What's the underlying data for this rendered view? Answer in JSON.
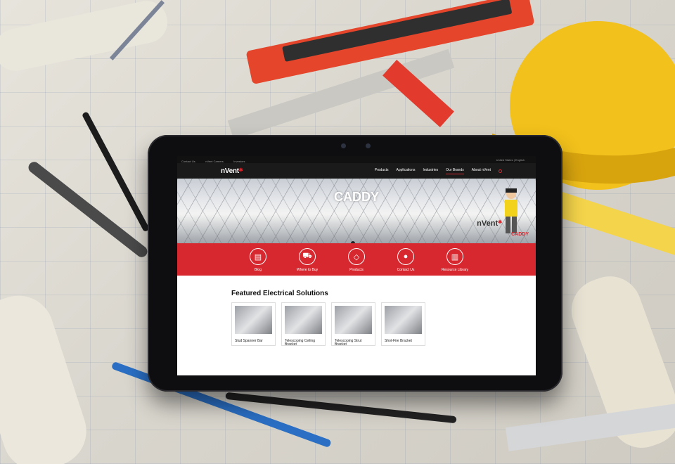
{
  "utility_bar": {
    "left_links": [
      "Contact Us",
      "nVent Careers",
      "Investors"
    ],
    "locale": "United States | English"
  },
  "nav": {
    "logo": "nVent",
    "items": [
      "Products",
      "Applications",
      "Industries",
      "Our Brands",
      "About nVent"
    ],
    "active_item": "Our Brands"
  },
  "hero": {
    "title": "CADDY",
    "brand": "nVent",
    "brand_sub": "CADDY"
  },
  "actions": [
    {
      "label": "Blog",
      "icon": "news-icon"
    },
    {
      "label": "Where to Buy",
      "icon": "cart-icon"
    },
    {
      "label": "Products",
      "icon": "tag-icon"
    },
    {
      "label": "Contact Us",
      "icon": "person-icon"
    },
    {
      "label": "Resource Library",
      "icon": "document-icon"
    }
  ],
  "featured": {
    "heading": "Featured Electrical Solutions",
    "products": [
      "Stud Spanner Bar",
      "Telescoping Ceiling Bracket",
      "Telescoping Strut Bracket",
      "Shot-Fire Bracket"
    ]
  },
  "colors": {
    "brand_red": "#d7282f",
    "nav_black": "#1a1a1a"
  }
}
